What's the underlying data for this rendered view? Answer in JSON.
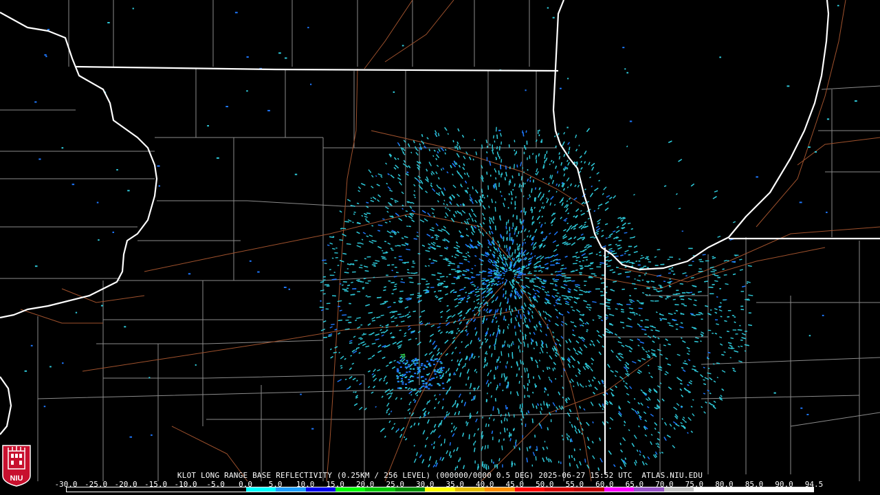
{
  "caption": "KLOT LONG RANGE BASE REFLECTIVITY (0.25KM / 256 LEVEL) (000000/0000 0.5 DEG) 2025-06-27 15:52 UTC  ATLAS.NIU.EDU",
  "logo": {
    "text": "NIU",
    "icon": "niu-logo-icon",
    "colors": {
      "background": "#c8102e",
      "foreground": "#ffffff"
    }
  },
  "scale": {
    "labels": [
      "-30.0",
      "-25.0",
      "-20.0",
      "-15.0",
      "-10.0",
      "-5.0",
      "0.0",
      "5.0",
      "10.0",
      "15.0",
      "20.0",
      "25.0",
      "30.0",
      "35.0",
      "40.0",
      "45.0",
      "50.0",
      "55.0",
      "60.0",
      "65.0",
      "70.0",
      "75.0",
      "80.0",
      "85.0",
      "90.0",
      "94.5"
    ],
    "colors": [
      "#000000",
      "#000000",
      "#000000",
      "#000000",
      "#000000",
      "#000000",
      "#00ffff",
      "#1ea0ff",
      "#0000f0",
      "#00ff00",
      "#00c800",
      "#009000",
      "#ffff00",
      "#e7c000",
      "#ff9000",
      "#ff0000",
      "#d60000",
      "#c00000",
      "#ff00ff",
      "#9955c9",
      "#c8c8c8",
      "#ffffff",
      "#ffffff",
      "#ffffff",
      "#ffffff"
    ]
  },
  "map": {
    "colors": {
      "background": "#000000",
      "state_lines": "#ffffff",
      "county_lines": "#8c8c8c",
      "highways": "#a0522d",
      "echo_main": "#2ec8d8",
      "echo_blue": "#1e78ff",
      "echo_green": "#2fc24a"
    }
  }
}
